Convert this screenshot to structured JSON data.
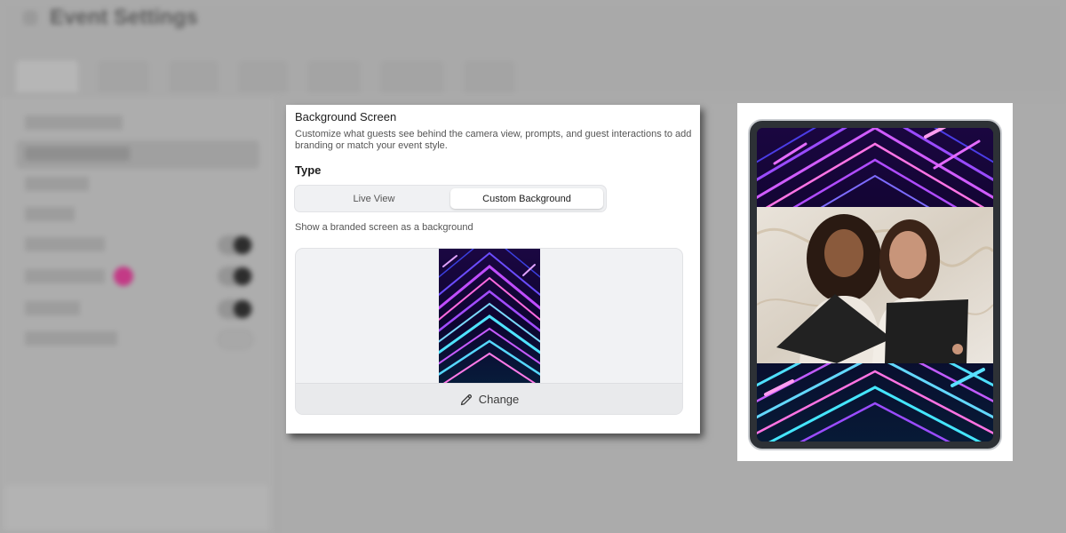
{
  "background_app": {
    "title": "Event Settings",
    "subtitle": "",
    "tabs": [
      "",
      "",
      "",
      "",
      "",
      "",
      ""
    ],
    "sidebar_items": [
      "",
      "",
      "",
      "",
      "",
      "",
      "",
      ""
    ],
    "footer_note": ""
  },
  "panel": {
    "title": "Background Screen",
    "description": "Customize what guests see behind the camera view, prompts, and guest interactions to add branding or match your event style.",
    "type_heading": "Type",
    "type_options": [
      "Live View",
      "Custom Background"
    ],
    "selected_type": "Custom Background",
    "helper_text": "Show a branded screen as a background",
    "change_label": "Change"
  },
  "icons": {
    "change": "pencil-icon"
  },
  "colors": {
    "neon_purple": "#b04cff",
    "neon_pink": "#ff4fd8",
    "neon_cyan": "#3fe0ff",
    "night": "#090320"
  }
}
